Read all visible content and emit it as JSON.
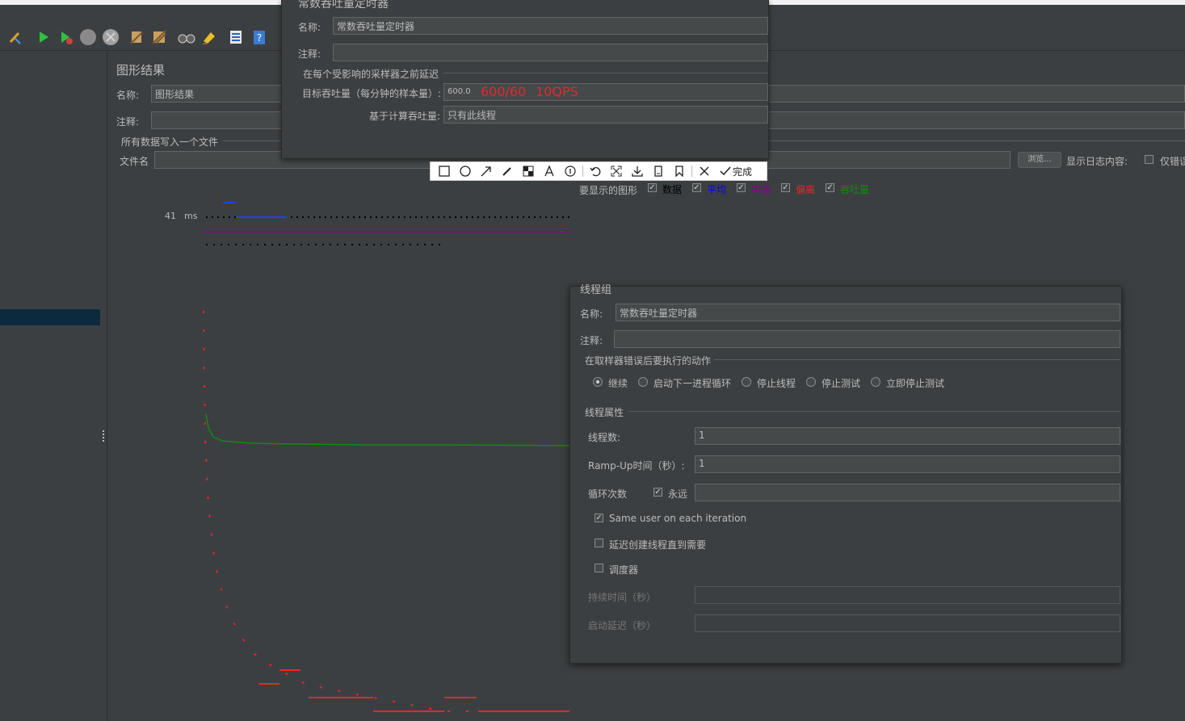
{
  "graph_panel": {
    "title": "图形结果",
    "name_label": "名称:",
    "name_value": "图形结果",
    "comment_label": "注释:",
    "write_all_label": "所有数据写入一个文件",
    "filename_label": "文件名",
    "browse_label": "浏览...",
    "log_content_label": "显示日志内容:",
    "errors_only_label": "仅错误",
    "graphs_label": "要显示的图形",
    "legend": [
      {
        "label": "数据",
        "color": "#000000",
        "checked": true
      },
      {
        "label": "平均",
        "color": "#0000ff",
        "checked": true
      },
      {
        "label": "中值",
        "color": "#8b008b",
        "checked": true
      },
      {
        "label": "偏离",
        "color": "#e8262b",
        "checked": true
      },
      {
        "label": "吞吐量",
        "color": "#138a13",
        "checked": true
      }
    ],
    "y_value": "41",
    "y_unit": "ms"
  },
  "timer_dialog": {
    "title": "常数吞吐量定时器",
    "name_label": "名称:",
    "name_value": "常数吞吐量定时器",
    "comment_label": "注释:",
    "group_label": "在每个受影响的采样器之前延迟",
    "target_label": "目标吞吐量（每分钟的样本量）:",
    "target_value": "600.0",
    "annotation_1": "600/60",
    "annotation_2": "10QPS",
    "basis_label": "基于计算吞吐量:",
    "basis_value": "只有此线程"
  },
  "annot_toolbar": {
    "done_label": "完成"
  },
  "thread_dialog": {
    "title": "线程组",
    "name_label": "名称:",
    "name_value": "常数吞吐量定时器",
    "comment_label": "注释:",
    "error_group_label": "在取样器错误后要执行的动作",
    "error_options": [
      {
        "label": "继续",
        "selected": true
      },
      {
        "label": "启动下一进程循环",
        "selected": false
      },
      {
        "label": "停止线程",
        "selected": false
      },
      {
        "label": "停止测试",
        "selected": false
      },
      {
        "label": "立即停止测试",
        "selected": false
      }
    ],
    "props_group_label": "线程属性",
    "threads_label": "线程数:",
    "threads_value": "1",
    "rampup_label": "Ramp-Up时间（秒）:",
    "rampup_value": "1",
    "loop_label": "循环次数",
    "forever_label": "永远",
    "same_user_label": "Same user on each iteration",
    "delay_label": "延迟创建线程直到需要",
    "scheduler_label": "调度器",
    "duration_label": "持续时间（秒）",
    "startup_delay_label": "启动延迟（秒）"
  }
}
